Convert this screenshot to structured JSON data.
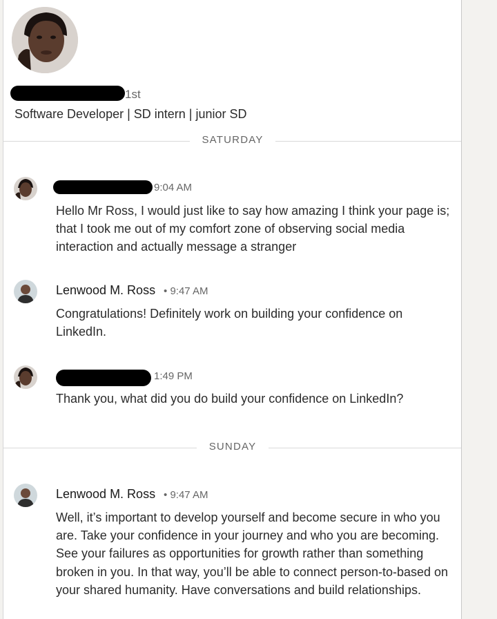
{
  "profile": {
    "degree": "1st",
    "headline": "Software Developer | SD intern | junior SD"
  },
  "days": {
    "saturday": "SATURDAY",
    "sunday": "SUNDAY"
  },
  "messages": [
    {
      "sender": "",
      "time": "9:04 AM",
      "text": "Hello Mr Ross, I would just like to say how amazing I think your page is; that I took me out of my comfort zone of observing social media interaction and actually message a stranger"
    },
    {
      "sender": "Lenwood M. Ross",
      "separator": "•",
      "time": "9:47 AM",
      "text": "Congratulations! Definitely work on building your confidence on LinkedIn."
    },
    {
      "sender": "",
      "time": "1:49 PM",
      "text": "Thank you, what did you do build your confidence on LinkedIn?"
    },
    {
      "sender": "Lenwood M. Ross",
      "separator": "•",
      "time": "9:47 AM",
      "text": "Well, it’s important to develop yourself and become secure in who you are. Take your confidence in your journey and who you are becoming. See your failures as opportunities for growth rather than something broken in you. In that way, you’ll be able to connect person-to-based on your shared humanity. Have conversations and build relationships."
    }
  ],
  "icons": {
    "profile_photo": "profile-photo",
    "avatar_user": "user-avatar",
    "avatar_ross": "ross-avatar"
  },
  "colors": {
    "background": "#f3f2ef",
    "panel": "#ffffff",
    "muted_text": "#666666",
    "text": "#191919",
    "redaction": "#000000"
  }
}
